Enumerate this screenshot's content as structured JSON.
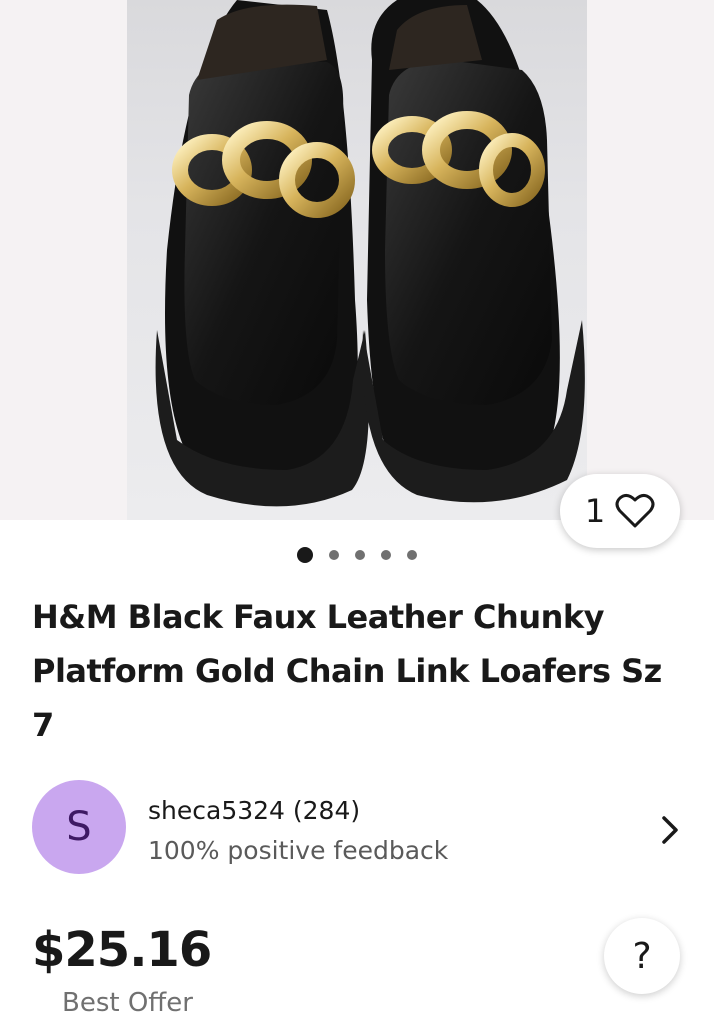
{
  "listing": {
    "title": "H&M Black Faux Leather Chunky Platform Gold Chain Link Loafers Sz 7",
    "image_alt": "Black faux leather chunky platform loafers with gold chain link detail",
    "image_count": 5,
    "active_image_index": 0,
    "watch_count": "1",
    "watch_icon": "heart-outline-icon"
  },
  "seller": {
    "avatar_letter": "S",
    "avatar_color": "#c9a7ef",
    "name_with_score": "sheca5324 (284)",
    "feedback": "100% positive feedback"
  },
  "pricing": {
    "price": "$25.16",
    "offer_label": "Best Offer"
  },
  "help": {
    "glyph": "?"
  },
  "colors": {
    "text": "#191919",
    "secondary_text": "#707070",
    "gallery_bg": "#f5f2f3"
  }
}
